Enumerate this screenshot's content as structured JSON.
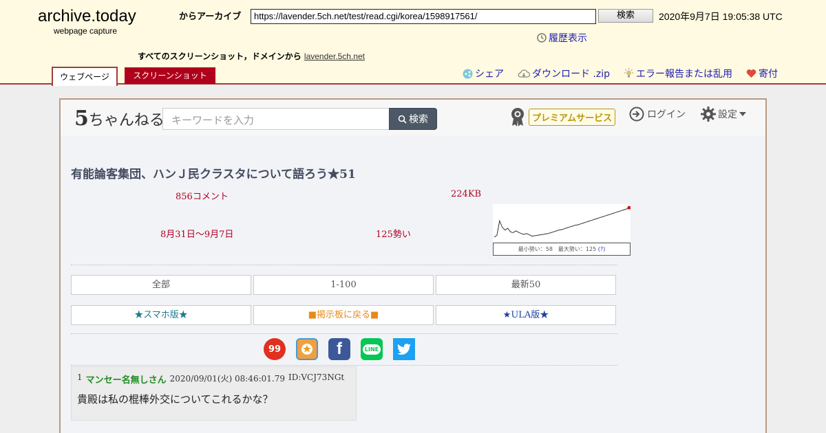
{
  "archive": {
    "logo": "archive.today",
    "subtitle": "webpage capture",
    "from_label": "からアーカイブ",
    "url": "https://lavender.5ch.net/test/read.cgi/korea/1598917561/",
    "search_label": "検索",
    "date": "2020年9月7日 19:05:38 UTC",
    "history_label": "履歴表示",
    "all_screens_label": "すべてのスクリーンショット，ドメインから",
    "domain": "lavender.5ch.net",
    "tabs": {
      "webpage": "ウェブページ",
      "screenshot": "スクリーンショット"
    },
    "actions": {
      "share": "シェア",
      "download": "ダウンロード .zip",
      "report": "エラー報告または乱用",
      "donate": "寄付"
    }
  },
  "site": {
    "logo_num": "5",
    "logo_text": "ちゃんねる",
    "search_placeholder": "キーワードを入力",
    "search_label": "検索",
    "premium_label": "プレミアムサービス",
    "login_label": "ログイン",
    "settings_label": "設定"
  },
  "thread": {
    "title": "有能論客集団、ハンＪ民クラスタについて語ろう★51",
    "comments": "856コメント",
    "size": "224KB",
    "range": "8月31日〜9月7日",
    "speed": "125勢い",
    "spark_legend": "最小勢い：58　最大勢い：125",
    "spark_q": "(?)"
  },
  "nav": {
    "all": "全部",
    "range": "1-100",
    "latest": "最新50",
    "smartphone": "★スマホ版★",
    "back": "■掲示板に戻る■",
    "ula": "★ULA版★"
  },
  "share_icons": [
    "99-icon",
    "bookmark-icon",
    "facebook-icon",
    "line-icon",
    "twitter-icon"
  ],
  "share_text": {
    "s99": "99",
    "facebook": "f",
    "line": "LINE"
  },
  "post": {
    "number": "1",
    "name": "マンセー名無しさん",
    "date": "2020/09/01(火) 08:46:01.79",
    "id": "ID:VCJ73NGt",
    "body": "貴殿は私の棍棒外交についてこれるかな？"
  },
  "colors": {
    "accent": "#b0001c",
    "link": "#2020b0",
    "premium": "#b8970d"
  },
  "chart_data": {
    "type": "line",
    "title": "",
    "xlabel": "",
    "ylabel": "",
    "x": [
      0,
      2,
      4,
      6,
      8,
      10,
      12,
      14,
      16,
      18,
      20,
      22,
      24,
      26,
      28,
      30,
      32,
      34,
      36,
      38,
      40,
      42,
      44,
      46,
      48,
      50,
      52,
      54,
      56,
      58,
      60,
      62,
      64,
      66,
      68,
      70,
      72,
      74,
      76,
      78,
      80,
      82,
      84,
      86,
      88,
      90,
      92,
      94,
      96,
      98,
      100
    ],
    "values": [
      58,
      62,
      95,
      80,
      74,
      78,
      70,
      68,
      72,
      69,
      66,
      64,
      66,
      63,
      60,
      61,
      62,
      63,
      64,
      65,
      66,
      68,
      70,
      72,
      74,
      75,
      77,
      79,
      81,
      83,
      85,
      86,
      88,
      90,
      92,
      94,
      96,
      98,
      100,
      102,
      104,
      106,
      108,
      110,
      112,
      114,
      116,
      118,
      120,
      122,
      125
    ],
    "ylim": [
      50,
      130
    ],
    "grid": false
  }
}
